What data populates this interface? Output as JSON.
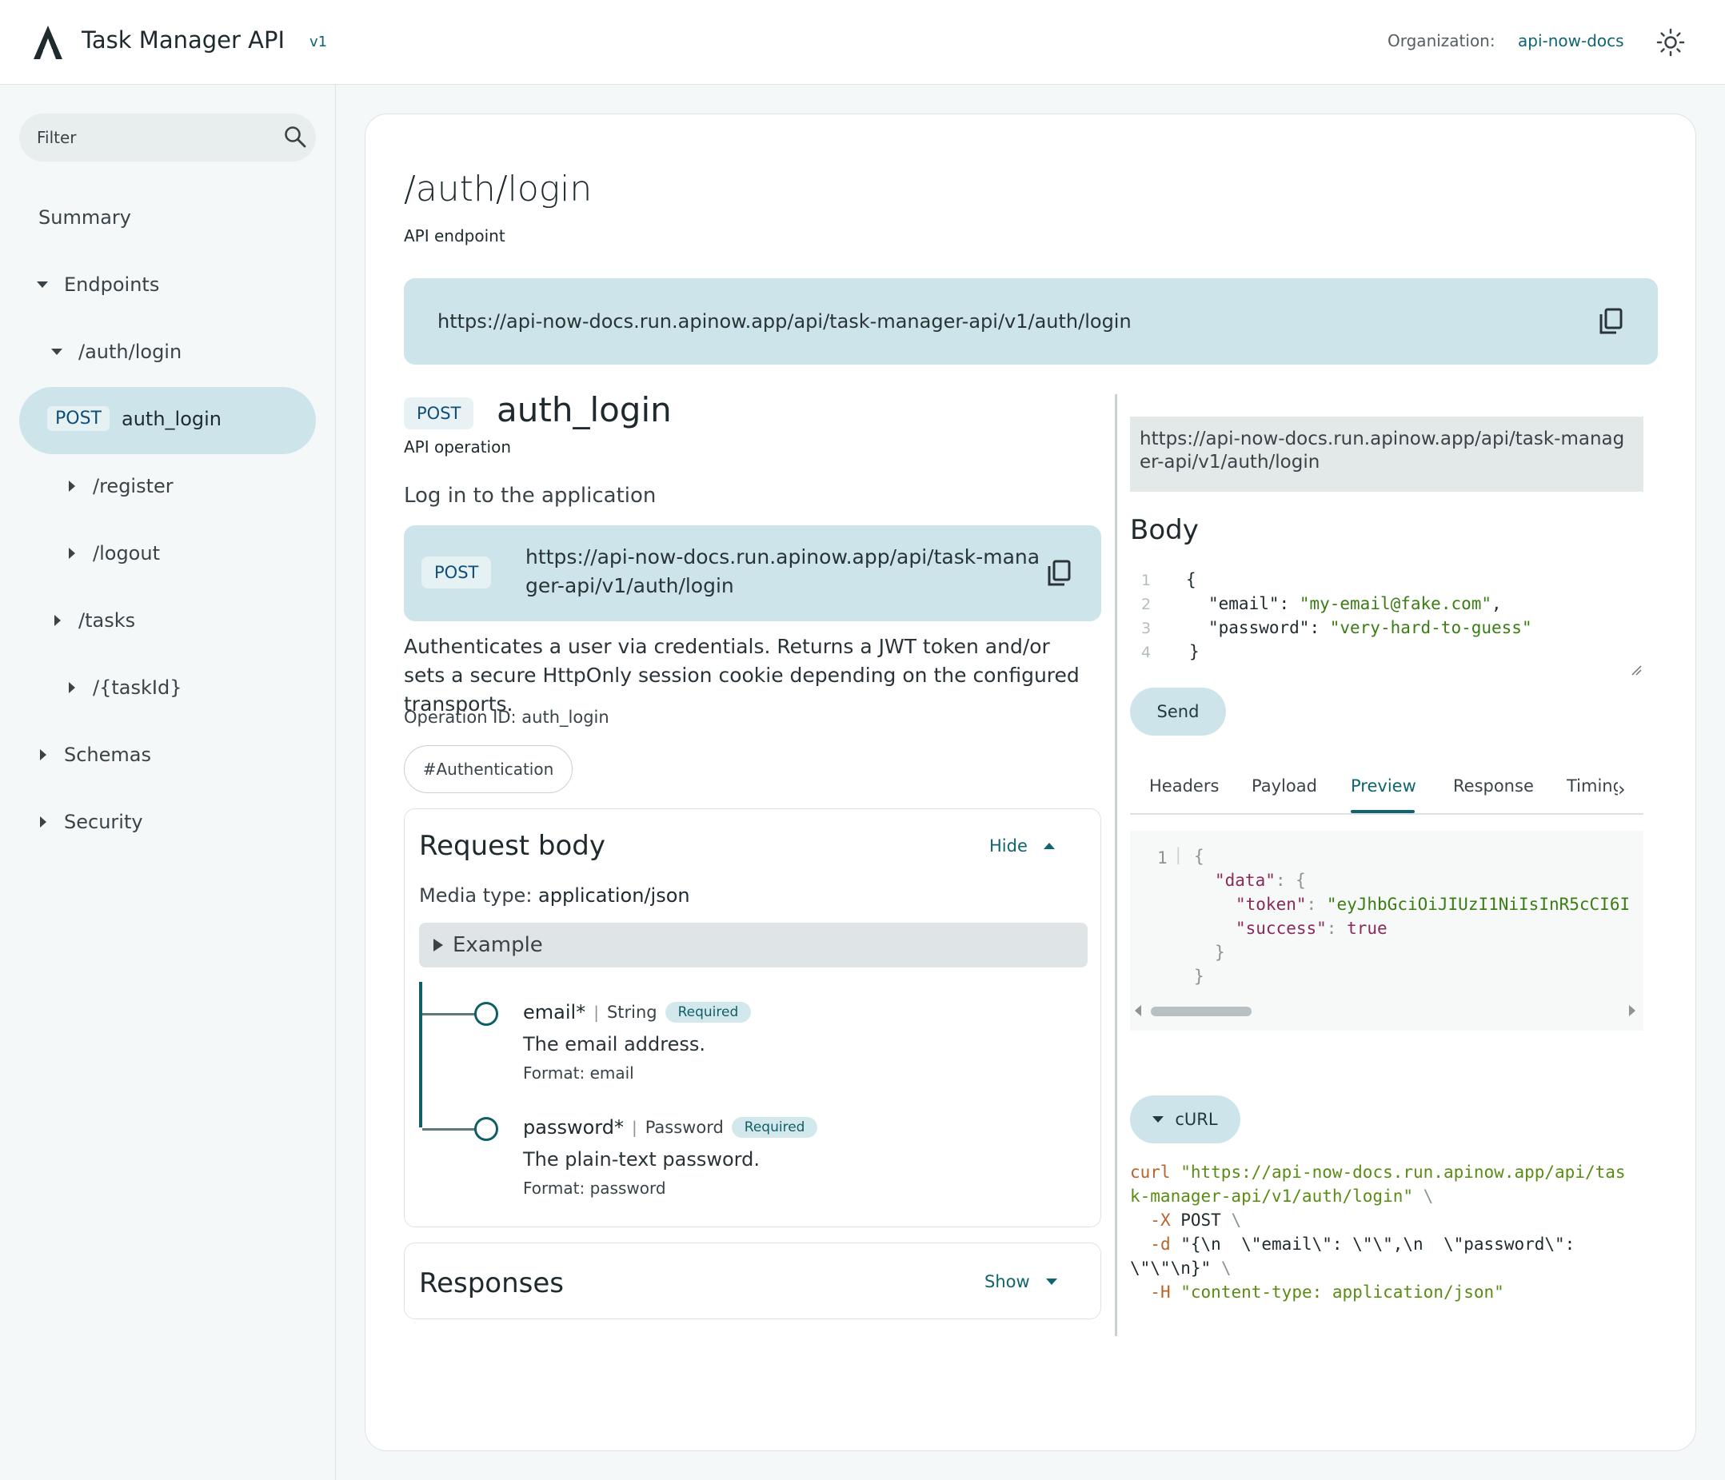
{
  "header": {
    "title": "Task Manager API",
    "version": "v1",
    "org_label": "Organization:",
    "org_value": "api-now-docs",
    "logo_icon": "a-logo-icon",
    "theme_icon": "sun-icon"
  },
  "sidebar": {
    "filter_placeholder": "Filter",
    "filter_icon": "search-icon",
    "items": [
      {
        "label": "Summary"
      },
      {
        "label": "Endpoints"
      },
      {
        "label": "/auth/login"
      },
      {
        "method": "POST",
        "label": "auth_login"
      },
      {
        "label": "/register"
      },
      {
        "label": "/logout"
      },
      {
        "label": "/tasks"
      },
      {
        "label": "/{taskId}"
      },
      {
        "label": "Schemas"
      },
      {
        "label": "Security"
      }
    ]
  },
  "main": {
    "title": "/auth/login",
    "subtitle": "API endpoint",
    "url": "https://api-now-docs.run.apinow.app/api/task-manager-api/v1/auth/login",
    "operation": {
      "method": "POST",
      "name": "auth_login",
      "subtitle": "API operation",
      "summary": "Log in to the application",
      "url": "https://api-now-docs.run.apinow.app/api/task-manager-api/v1/auth/login",
      "description": "Authenticates a user via credentials. Returns a JWT token and/or sets a secure HttpOnly session cookie depending on the configured transports.",
      "operation_id": "Operation ID: auth_login",
      "tag": "#Authentication"
    },
    "request_body": {
      "title": "Request body",
      "toggle": "Hide",
      "media_type_label": "Media type: ",
      "media_type": "application/json",
      "example_label": "Example",
      "properties": [
        {
          "name": "email*",
          "type": "String",
          "badge": "Required",
          "description": "The email address.",
          "format": "Format: email"
        },
        {
          "name": "password*",
          "type": "Password",
          "badge": "Required",
          "description": "The plain-text password.",
          "format": "Format: password"
        }
      ]
    },
    "responses": {
      "title": "Responses",
      "toggle": "Show"
    }
  },
  "try_it": {
    "url": "https://api-now-docs.run.apinow.app/api/task-manager-api/v1/auth/login",
    "body_title": "Body",
    "body_lines": [
      "{",
      "  \"email\": \"my-email@fake.com\",",
      "  \"password\": \"very-hard-to-guess\"",
      "}"
    ],
    "body_email_key": "\"email\"",
    "body_email_val": "\"my-email@fake.com\"",
    "body_password_key": "\"password\"",
    "body_password_val": "\"very-hard-to-guess\"",
    "line_numbers": [
      "1",
      "2",
      "3",
      "4"
    ],
    "send_label": "Send",
    "tabs": [
      "Headers",
      "Payload",
      "Preview",
      "Response",
      "Timings"
    ],
    "active_tab": "Preview",
    "preview": {
      "line_number": "1",
      "open": "{",
      "data_key": "\"data\"",
      "token_key": "\"token\"",
      "token_val": "\"eyJhbGciOiJIUzI1NiIsInR5cCI6I",
      "success_key": "\"success\"",
      "success_val": "true",
      "close_inner": "}",
      "close_outer": "}"
    },
    "curl_label": "cURL",
    "curl": {
      "cmd": "curl",
      "url_line1": "\"https://api-now-docs.run.apinow.app/api/tas",
      "url_line2": "k-manager-api/v1/auth/login\"",
      "flag_x": "-X",
      "x_val": "POST",
      "flag_d": "-d",
      "d_val_line1": "\"{\\n  \\\"email\\\": \\\"\\\",\\n  \\\"password\\\":",
      "d_val_line2": "\\\"\\\"\\n}\"",
      "flag_h": "-H",
      "h_val": "\"content-type: application/json\"",
      "cont": "\\"
    }
  },
  "colors": {
    "accent": "#0f6470",
    "highlight": "#cde5ea"
  }
}
